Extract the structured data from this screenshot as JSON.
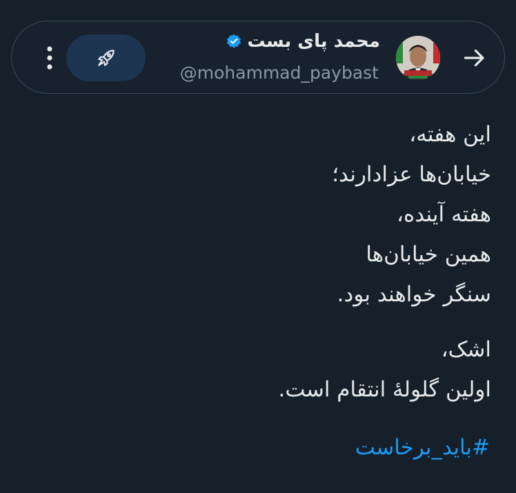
{
  "header": {
    "display_name": "محمد پای بست",
    "handle": "@mohammad_paybast",
    "verified": true,
    "back_icon": "arrow-right-icon",
    "verified_icon": "verified-badge-icon",
    "boost_icon": "rocket-icon",
    "more_icon": "more-vertical-icon"
  },
  "tweet": {
    "paragraphs": [
      [
        "این هفته،",
        "خیابان‌ها عزادارند؛",
        "هفته آینده،",
        "همین خیابان‌ها",
        "سنگر خواهند بود."
      ],
      [
        "اشک،",
        "اولین گلولهٔ انتقام است."
      ]
    ],
    "hashtag": "#باید_برخاست"
  },
  "colors": {
    "background": "#15202b",
    "text": "#e7e9ea",
    "secondary_text": "#8b98a5",
    "accent": "#1d9bf0",
    "boost_button_bg": "#1d3550"
  }
}
